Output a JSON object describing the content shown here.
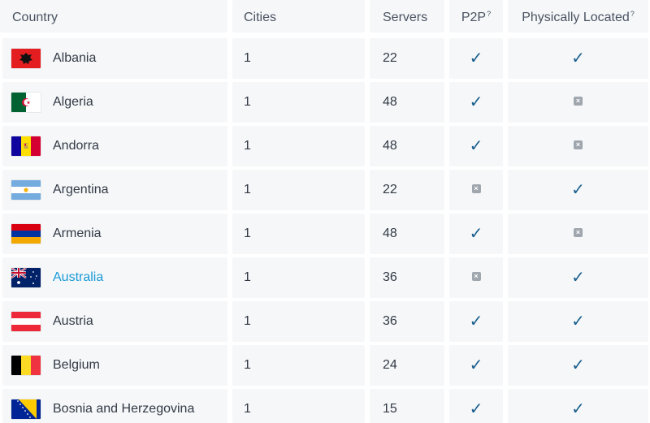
{
  "header": {
    "country": "Country",
    "cities": "Cities",
    "servers": "Servers",
    "p2p": "P2P",
    "p2p_sup": "?",
    "physically": "Physically Located",
    "physically_sup": "?"
  },
  "rows": [
    {
      "country": "Albania",
      "cities": "1",
      "servers": "22",
      "p2p": true,
      "physical": true,
      "link": false,
      "flag": "albania-flag-icon"
    },
    {
      "country": "Algeria",
      "cities": "1",
      "servers": "48",
      "p2p": true,
      "physical": false,
      "link": false,
      "flag": "algeria-flag-icon"
    },
    {
      "country": "Andorra",
      "cities": "1",
      "servers": "48",
      "p2p": true,
      "physical": false,
      "link": false,
      "flag": "andorra-flag-icon"
    },
    {
      "country": "Argentina",
      "cities": "1",
      "servers": "22",
      "p2p": false,
      "physical": true,
      "link": false,
      "flag": "argentina-flag-icon"
    },
    {
      "country": "Armenia",
      "cities": "1",
      "servers": "48",
      "p2p": true,
      "physical": false,
      "link": false,
      "flag": "armenia-flag-icon"
    },
    {
      "country": "Australia",
      "cities": "1",
      "servers": "36",
      "p2p": false,
      "physical": true,
      "link": true,
      "flag": "australia-flag-icon"
    },
    {
      "country": "Austria",
      "cities": "1",
      "servers": "36",
      "p2p": true,
      "physical": true,
      "link": false,
      "flag": "austria-flag-icon"
    },
    {
      "country": "Belgium",
      "cities": "1",
      "servers": "24",
      "p2p": true,
      "physical": true,
      "link": false,
      "flag": "belgium-flag-icon"
    },
    {
      "country": "Bosnia and Herzegovina",
      "cities": "1",
      "servers": "15",
      "p2p": true,
      "physical": true,
      "link": false,
      "flag": "bosnia-flag-icon"
    }
  ],
  "icons": {
    "check": "✓",
    "cross": "×"
  },
  "colors": {
    "check": "#1a5f8e",
    "link": "#1b9ad6",
    "cross_bg": "#a0a6ae",
    "cell_bg": "#f5f7f9"
  }
}
